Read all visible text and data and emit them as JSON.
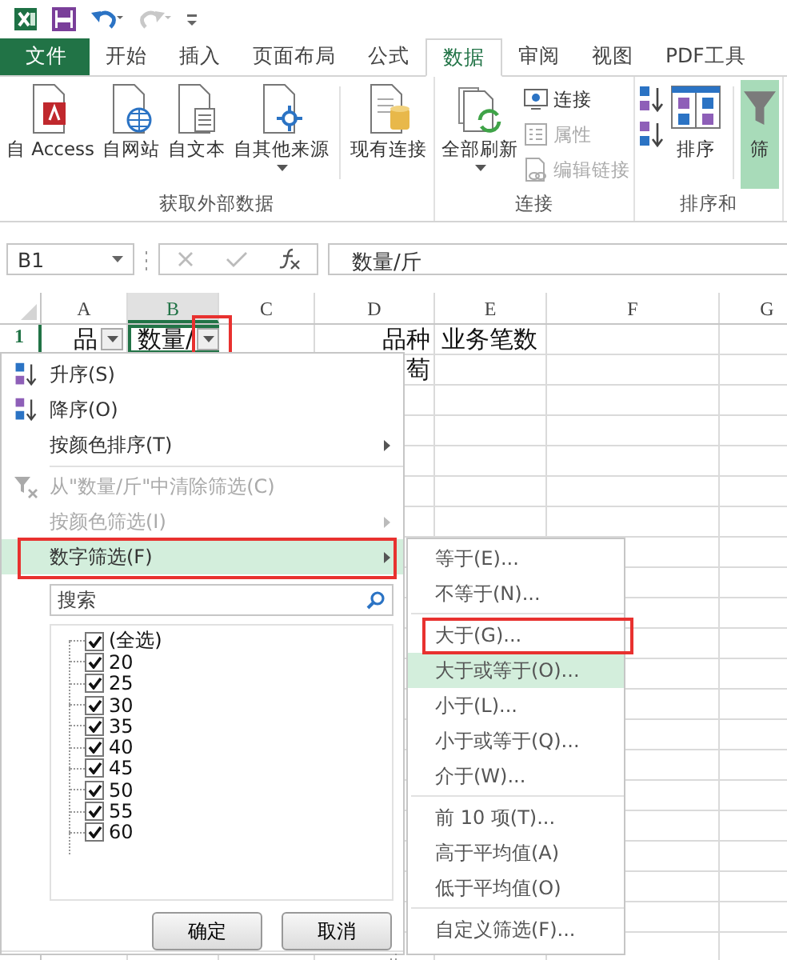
{
  "quick_access": {
    "undo": {
      "disabled": false
    },
    "redo": {
      "disabled": true
    }
  },
  "tabs": [
    {
      "label": "文件",
      "kind": "file",
      "selected": false
    },
    {
      "label": "开始",
      "kind": "tab",
      "selected": false
    },
    {
      "label": "插入",
      "kind": "tab",
      "selected": false
    },
    {
      "label": "页面布局",
      "kind": "tab",
      "selected": false
    },
    {
      "label": "公式",
      "kind": "tab",
      "selected": false
    },
    {
      "label": "数据",
      "kind": "tab",
      "selected": true
    },
    {
      "label": "审阅",
      "kind": "tab",
      "selected": false
    },
    {
      "label": "视图",
      "kind": "tab",
      "selected": false
    },
    {
      "label": "PDF工具",
      "kind": "tab",
      "selected": false
    }
  ],
  "ribbon": {
    "groups": [
      {
        "label": "获取外部数据",
        "items": [
          {
            "kind": "large",
            "label": "自 Access"
          },
          {
            "kind": "large",
            "label": "自网站"
          },
          {
            "kind": "large",
            "label": "自文本"
          },
          {
            "kind": "large",
            "label": "自其他来源",
            "dropdown": true
          },
          {
            "kind": "separator"
          },
          {
            "kind": "large",
            "label": "现有连接"
          }
        ]
      },
      {
        "label": "连接",
        "items": [
          {
            "kind": "large",
            "label": "全部刷新",
            "dropdown": true
          },
          {
            "kind": "stack",
            "items": [
              {
                "label": "连接",
                "disabled": false
              },
              {
                "label": "属性",
                "disabled": true
              },
              {
                "label": "编辑链接",
                "disabled": true
              }
            ]
          }
        ]
      },
      {
        "label": "排序和",
        "items": [
          {
            "kind": "sort_buttons"
          },
          {
            "kind": "large",
            "label": "排序"
          },
          {
            "kind": "separator"
          },
          {
            "kind": "large",
            "label": "筛",
            "active": true
          }
        ]
      }
    ]
  },
  "formula_bar": {
    "name_box": "B1",
    "formula": "数量/斤"
  },
  "sheet": {
    "columns": [
      {
        "label": "A",
        "selected": false
      },
      {
        "label": "B",
        "selected": true
      },
      {
        "label": "C",
        "selected": false
      },
      {
        "label": "D",
        "selected": false
      },
      {
        "label": "E",
        "selected": false
      },
      {
        "label": "F",
        "selected": false
      },
      {
        "label": "G",
        "selected": false
      }
    ],
    "rows": [
      {
        "header": "1",
        "selected": true,
        "cells": [
          {
            "text": "品",
            "filter": true
          },
          {
            "text": "数量/",
            "filter": true,
            "annotated": true
          },
          {},
          {
            "text": "品种"
          },
          {
            "text": "业务笔数"
          }
        ]
      },
      {
        "cells": [
          {},
          {},
          {},
          {
            "text": "萄"
          }
        ]
      }
    ]
  },
  "filter_menu": {
    "items": [
      {
        "kind": "item",
        "label": "升序(S)",
        "disabled": false,
        "submenu": false,
        "selected": false
      },
      {
        "kind": "item",
        "label": "降序(O)",
        "disabled": false,
        "submenu": false,
        "selected": false
      },
      {
        "kind": "item",
        "label": "按颜色排序(T)",
        "disabled": false,
        "submenu": true,
        "selected": false
      },
      {
        "kind": "separator"
      },
      {
        "kind": "item",
        "label": "从\"数量/斤\"中清除筛选(C)",
        "disabled": true,
        "submenu": false,
        "selected": false
      },
      {
        "kind": "item",
        "label": "按颜色筛选(I)",
        "disabled": true,
        "submenu": true,
        "selected": false
      },
      {
        "kind": "item",
        "label": "数字筛选(F)",
        "disabled": false,
        "submenu": true,
        "selected": true,
        "annotated": true
      }
    ],
    "search": {
      "placeholder": "搜索"
    },
    "values": [
      {
        "label": "(全选)",
        "checked": true
      },
      {
        "label": "20",
        "checked": true
      },
      {
        "label": "25",
        "checked": true
      },
      {
        "label": "30",
        "checked": true
      },
      {
        "label": "35",
        "checked": true
      },
      {
        "label": "40",
        "checked": true
      },
      {
        "label": "45",
        "checked": true
      },
      {
        "label": "50",
        "checked": true
      },
      {
        "label": "55",
        "checked": true
      },
      {
        "label": "60",
        "checked": true
      }
    ],
    "buttons": [
      "确定",
      "取消"
    ]
  },
  "number_filter_menu": {
    "items": [
      {
        "kind": "item",
        "label": "等于(E)...",
        "selected": false
      },
      {
        "kind": "item",
        "label": "不等于(N)...",
        "selected": false
      },
      {
        "kind": "separator"
      },
      {
        "kind": "item",
        "label": "大于(G)...",
        "selected": false,
        "annotated": true
      },
      {
        "kind": "item",
        "label": "大于或等于(O)...",
        "selected": true
      },
      {
        "kind": "item",
        "label": "小于(L)...",
        "selected": false
      },
      {
        "kind": "item",
        "label": "小于或等于(Q)...",
        "selected": false
      },
      {
        "kind": "item",
        "label": "介于(W)...",
        "selected": false
      },
      {
        "kind": "separator"
      },
      {
        "kind": "item",
        "label": "前 10 项(T)...",
        "selected": false
      },
      {
        "kind": "item",
        "label": "高于平均值(A)",
        "selected": false
      },
      {
        "kind": "item",
        "label": "低于平均值(O)",
        "selected": false
      },
      {
        "kind": "separator"
      },
      {
        "kind": "item",
        "label": "自定义筛选(F)...",
        "selected": false
      }
    ]
  }
}
